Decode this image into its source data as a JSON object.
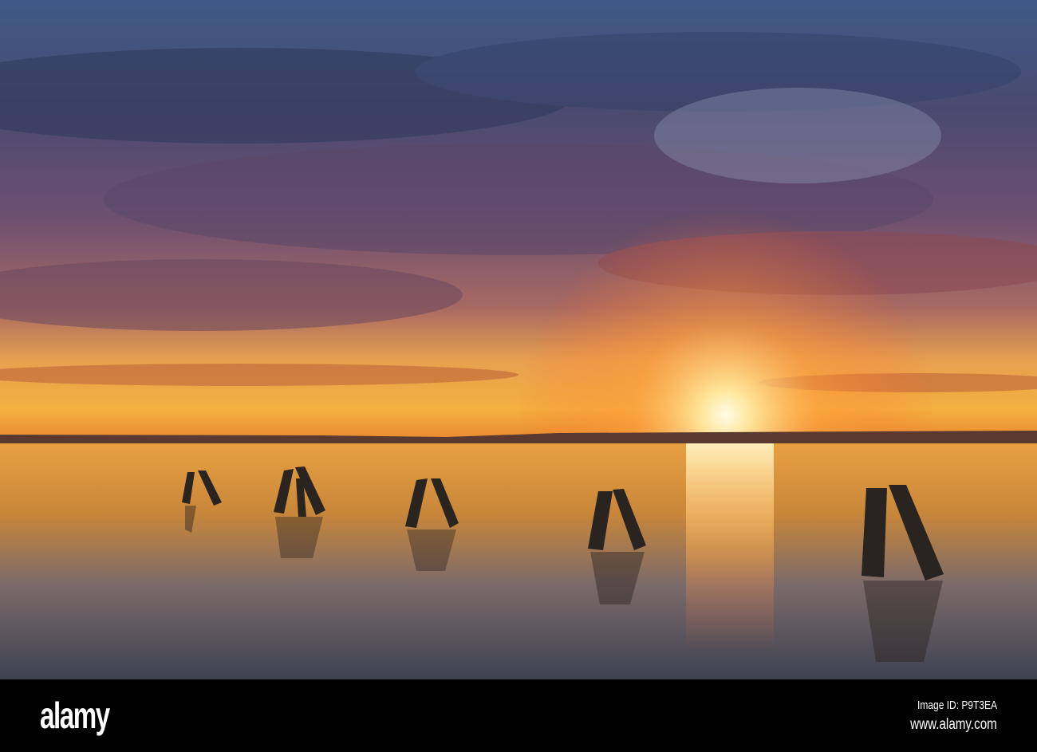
{
  "watermark": {
    "logo": "alamy",
    "image_id": "Image ID: P9T3EA",
    "url": "www.alamy.com"
  },
  "colors": {
    "sky_top": "#3b4b6e",
    "cloud_mauve": "#7a5a78",
    "horizon_orange": "#f08a2a",
    "sun": "#fff6d8",
    "water_dark": "#4a4c5a"
  }
}
